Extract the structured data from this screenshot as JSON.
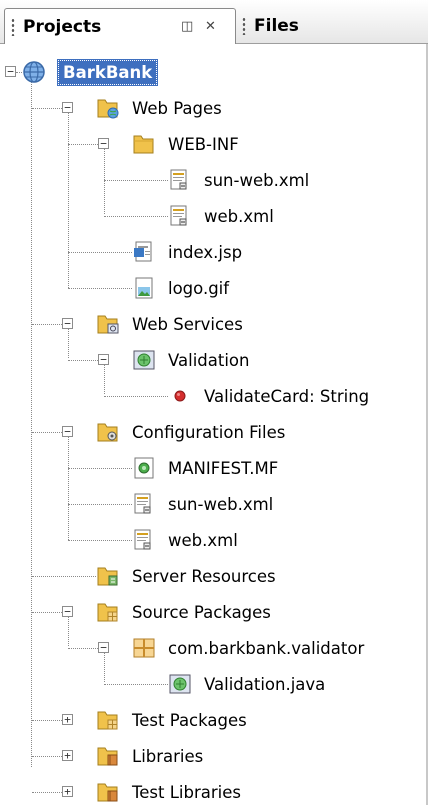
{
  "tabs": {
    "projects": "Projects",
    "files": "Files",
    "minimize_glyph": "◫",
    "close_glyph": "⌘"
  },
  "tree": {
    "root": "BarkBank",
    "web_pages": "Web Pages",
    "web_inf": "WEB-INF",
    "sun_web_xml_1": "sun-web.xml",
    "web_xml_1": "web.xml",
    "index_jsp": "index.jsp",
    "logo_gif": "logo.gif",
    "web_services": "Web Services",
    "validation": "Validation",
    "validate_card": "ValidateCard: String",
    "configuration_files": "Configuration Files",
    "manifest": "MANIFEST.MF",
    "sun_web_xml_2": "sun-web.xml",
    "web_xml_2": "web.xml",
    "server_resources": "Server Resources",
    "source_packages": "Source Packages",
    "package": "com.barkbank.validator",
    "validation_java": "Validation.java",
    "test_packages": "Test Packages",
    "libraries": "Libraries",
    "test_libraries": "Test Libraries",
    "expand_symbol": "+",
    "collapse_symbol": "−"
  },
  "colors": {
    "selection": "#3e6fbf",
    "folder": "#f0c24b",
    "error_dot": "#d42e2e"
  }
}
